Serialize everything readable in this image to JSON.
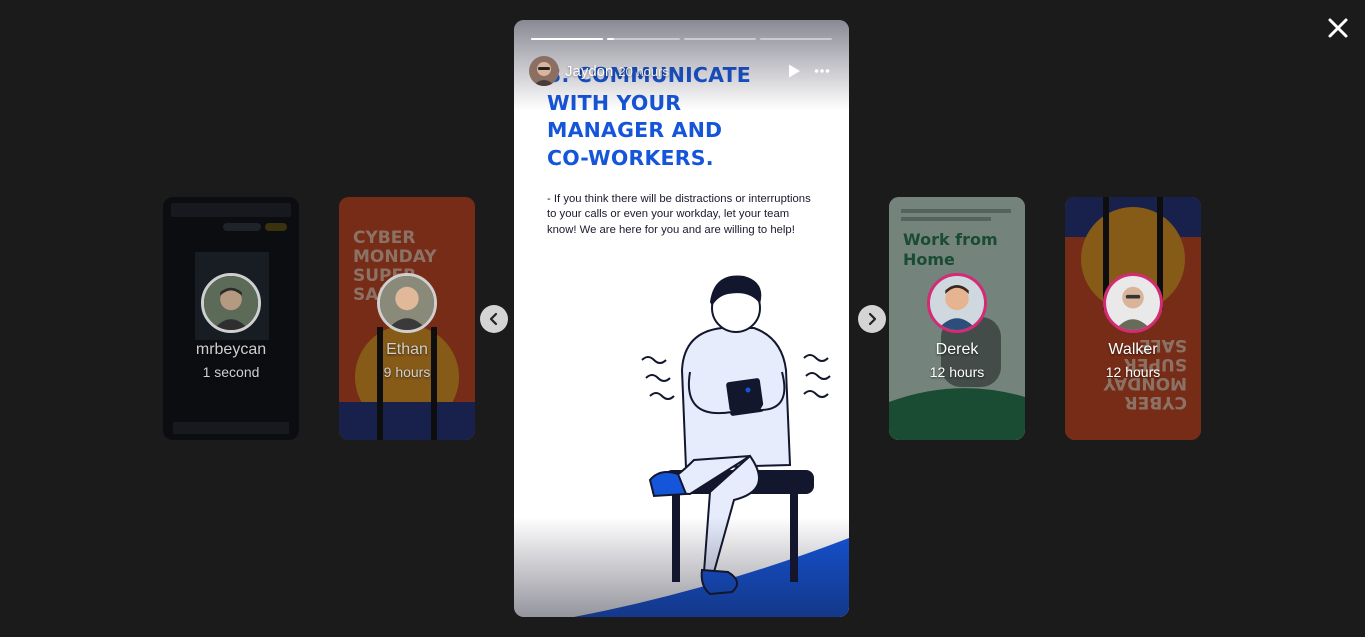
{
  "close": {
    "icon": "close-icon"
  },
  "cards": [
    {
      "name": "mrbeycan",
      "time": "1 second"
    },
    {
      "name": "Ethan",
      "time": "9 hours"
    },
    {
      "name": "Derek",
      "time": "12 hours"
    },
    {
      "name": "Walker",
      "time": "12 hours"
    }
  ],
  "story": {
    "user": "Jaydon",
    "time": "20 hours",
    "progress": [
      1.0,
      0.1,
      0.0,
      0.0
    ],
    "title": "3. COMMUNICATE\nWITH YOUR\nMANAGER AND\nCO-WORKERS.",
    "body": "- If you think there will be distractions or interruptions to your calls or even your workday, let your team know! We are here for you and are willing to help!",
    "controls": {
      "play": "play-icon",
      "more": "more-icon"
    }
  },
  "colors": {
    "background": "#1b1b1b",
    "accent_blue": "#1455d9",
    "ring_pink": "#d62976"
  }
}
